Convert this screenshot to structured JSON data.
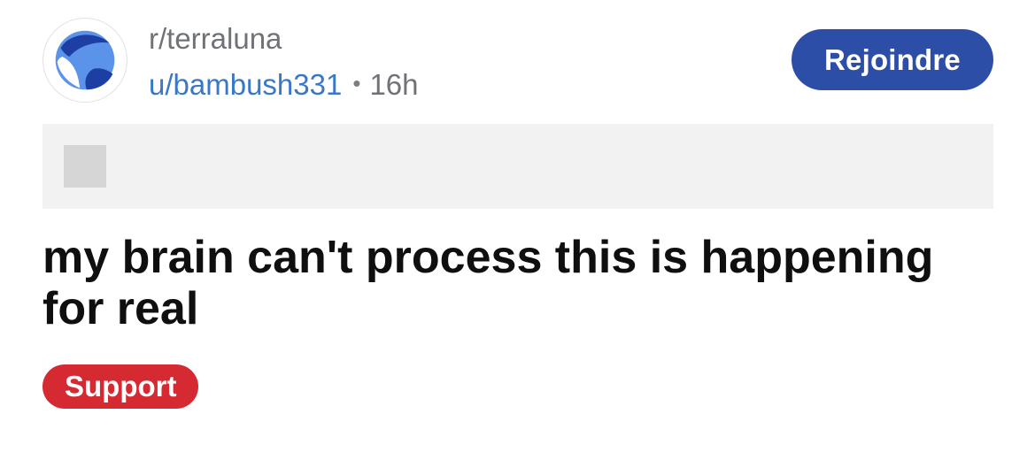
{
  "post_header": {
    "community_name": "r/terraluna",
    "author": "u/bambush331",
    "separator": "•",
    "time_ago": "16h",
    "join_label": "Rejoindre",
    "avatar_icon": "terra-luna-planet-icon"
  },
  "colors": {
    "join_button": "#2c4ea6",
    "username": "#3a78c5",
    "flair": "#d62a33",
    "media_strip": "#f2f2f2"
  },
  "post": {
    "media_icon": "image-placeholder-icon",
    "title": "my brain can't process this is happening for real",
    "flair": "Support"
  }
}
